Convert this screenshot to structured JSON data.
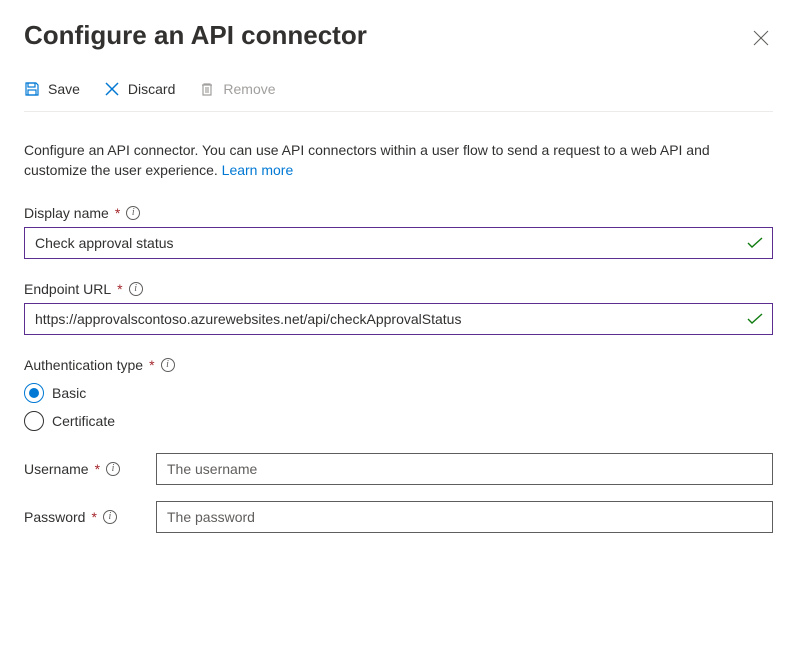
{
  "header": {
    "title": "Configure an API connector"
  },
  "toolbar": {
    "save_label": "Save",
    "discard_label": "Discard",
    "remove_label": "Remove"
  },
  "description": {
    "text": "Configure an API connector. You can use API connectors within a user flow to send a request to a web API and customize the user experience. ",
    "link_text": "Learn more"
  },
  "fields": {
    "display_name": {
      "label": "Display name",
      "value": "Check approval status"
    },
    "endpoint_url": {
      "label": "Endpoint URL",
      "value": "https://approvalscontoso.azurewebsites.net/api/checkApprovalStatus"
    },
    "auth_type": {
      "label": "Authentication type",
      "options": {
        "basic": "Basic",
        "certificate": "Certificate"
      }
    },
    "username": {
      "label": "Username",
      "placeholder": "The username"
    },
    "password": {
      "label": "Password",
      "placeholder": "The password"
    }
  }
}
